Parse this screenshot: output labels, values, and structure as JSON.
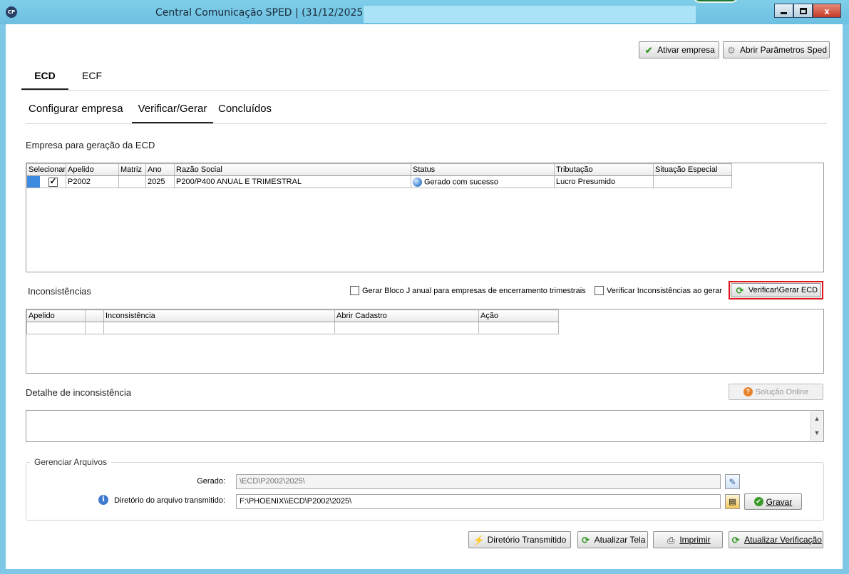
{
  "window": {
    "app_icon_text": "CP",
    "title": "Central Comunicação SPED | (31/12/2025) -",
    "close_glyph": "x"
  },
  "toolbar": {
    "activate_label": "Ativar empresa",
    "params_label": "Abrir Parâmetros Sped"
  },
  "main_tabs": [
    {
      "label": "ECD",
      "active": true
    },
    {
      "label": "ECF",
      "active": false
    }
  ],
  "sub_tabs": [
    {
      "label": "Configurar empresa",
      "active": false
    },
    {
      "label": "Verificar/Gerar",
      "active": true
    },
    {
      "label": "Concluídos",
      "active": false
    }
  ],
  "companies": {
    "section_title": "Empresa para geração da ECD",
    "columns": [
      "Selecionar",
      "Apelido",
      "Matriz",
      "Ano",
      "Razão Social",
      "Status",
      "Tributação",
      "Situação Especial"
    ],
    "rows": [
      {
        "selected": true,
        "apelido": "P2002",
        "matriz": "",
        "ano": "2025",
        "razao_social": "P200/P400 ANUAL E TRIMESTRAL",
        "status": "Gerado com sucesso",
        "tributacao": "Lucro Presumido",
        "situacao_especial": ""
      }
    ]
  },
  "inconsistencies": {
    "section_title": "Inconsistências",
    "opt_bloco_j": "Gerar Bloco J anual para empresas de encerramento trimestrais",
    "opt_verify": "Verificar Inconsistências ao gerar",
    "verify_button": "Verificar\\Gerar ECD",
    "columns": [
      "Apelido",
      "",
      "Inconsistência",
      "Abrir Cadastro",
      "Ação"
    ]
  },
  "detail": {
    "section_title": "Detalhe de inconsistência",
    "online_button": "Solução Online"
  },
  "files": {
    "group_title": "Gerenciar Arquivos",
    "generated_label": "Gerado:",
    "generated_value": "\\ECD\\P2002\\2025\\",
    "transmitted_label": "Diretório do arquivo transmitido:",
    "transmitted_value": "F:\\PHOENIX\\\\ECD\\P2002\\2025\\",
    "save_button": "Gravar"
  },
  "footer": {
    "transmitted_dir": "Diretório Transmitido",
    "refresh_screen": "Atualizar Tela",
    "print": "Imprimir",
    "refresh_check": "Atualizar Verificação"
  },
  "colors": {
    "title_bar": "#7fc7e6",
    "highlight_red": "#e0151c",
    "selection_blue": "#3d8be0"
  }
}
